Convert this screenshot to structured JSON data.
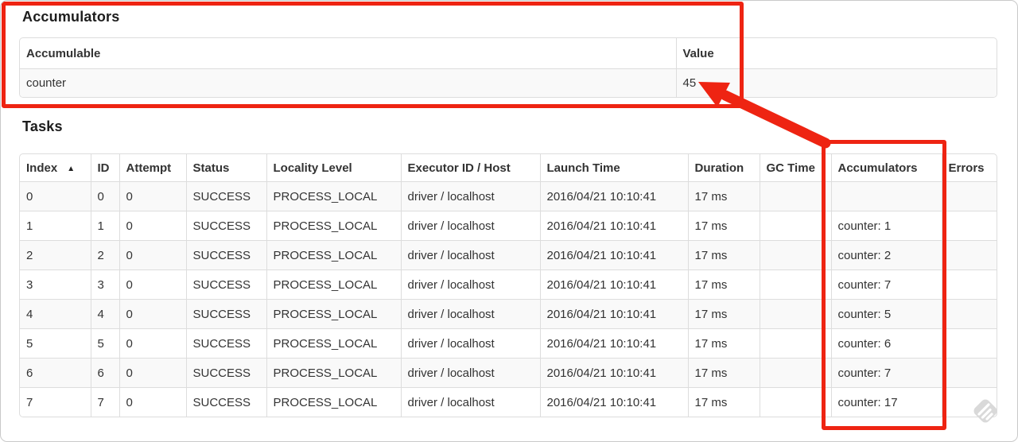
{
  "colors": {
    "annotation_red": "#ee2412",
    "table_border": "#dddddd",
    "row_stripe": "#f9f9f9",
    "watermark_gray": "#d9d9d9"
  },
  "accumulators_section": {
    "title": "Accumulators",
    "columns": [
      "Accumulable",
      "Value"
    ],
    "rows": [
      [
        "counter",
        "45"
      ]
    ]
  },
  "tasks_section": {
    "title": "Tasks",
    "sort_icon": "▲",
    "columns": [
      "Index",
      "ID",
      "Attempt",
      "Status",
      "Locality Level",
      "Executor ID / Host",
      "Launch Time",
      "Duration",
      "GC Time",
      "Accumulators",
      "Errors"
    ],
    "rows": [
      [
        "0",
        "0",
        "0",
        "SUCCESS",
        "PROCESS_LOCAL",
        "driver / localhost",
        "2016/04/21 10:10:41",
        "17 ms",
        "",
        "",
        ""
      ],
      [
        "1",
        "1",
        "0",
        "SUCCESS",
        "PROCESS_LOCAL",
        "driver / localhost",
        "2016/04/21 10:10:41",
        "17 ms",
        "",
        "counter: 1",
        ""
      ],
      [
        "2",
        "2",
        "0",
        "SUCCESS",
        "PROCESS_LOCAL",
        "driver / localhost",
        "2016/04/21 10:10:41",
        "17 ms",
        "",
        "counter: 2",
        ""
      ],
      [
        "3",
        "3",
        "0",
        "SUCCESS",
        "PROCESS_LOCAL",
        "driver / localhost",
        "2016/04/21 10:10:41",
        "17 ms",
        "",
        "counter: 7",
        ""
      ],
      [
        "4",
        "4",
        "0",
        "SUCCESS",
        "PROCESS_LOCAL",
        "driver / localhost",
        "2016/04/21 10:10:41",
        "17 ms",
        "",
        "counter: 5",
        ""
      ],
      [
        "5",
        "5",
        "0",
        "SUCCESS",
        "PROCESS_LOCAL",
        "driver / localhost",
        "2016/04/21 10:10:41",
        "17 ms",
        "",
        "counter: 6",
        ""
      ],
      [
        "6",
        "6",
        "0",
        "SUCCESS",
        "PROCESS_LOCAL",
        "driver / localhost",
        "2016/04/21 10:10:41",
        "17 ms",
        "",
        "counter: 7",
        ""
      ],
      [
        "7",
        "7",
        "0",
        "SUCCESS",
        "PROCESS_LOCAL",
        "driver / localhost",
        "2016/04/21 10:10:41",
        "17 ms",
        "",
        "counter: 17",
        ""
      ]
    ]
  },
  "annotations": {
    "section_box": "accumulators-section-highlight",
    "column_box": "accumulators-column-highlight",
    "arrow": "arrow-from-column-to-total-value"
  },
  "watermark": {
    "icon": "skitch-pen-watermark"
  }
}
